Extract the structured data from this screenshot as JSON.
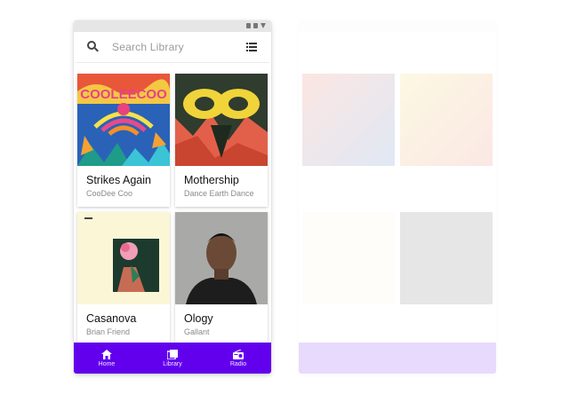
{
  "search": {
    "placeholder": "Search Library"
  },
  "albums": [
    {
      "title": "Strikes Again",
      "artist": "CooDee Coo"
    },
    {
      "title": "Mothership",
      "artist": "Dance Earth Dance"
    },
    {
      "title": "Casanova",
      "artist": "Brian Friend"
    },
    {
      "title": "Ology",
      "artist": "Gallant"
    }
  ],
  "bottom_nav": [
    {
      "label": "Home",
      "icon": "home-icon"
    },
    {
      "label": "Library",
      "icon": "library-icon"
    },
    {
      "label": "Radio",
      "icon": "radio-icon"
    }
  ],
  "colors": {
    "primary": "#6200ee",
    "status_bar": "#e6e6e6",
    "card_title": "#111111",
    "card_subtitle": "#8a8a8a"
  }
}
